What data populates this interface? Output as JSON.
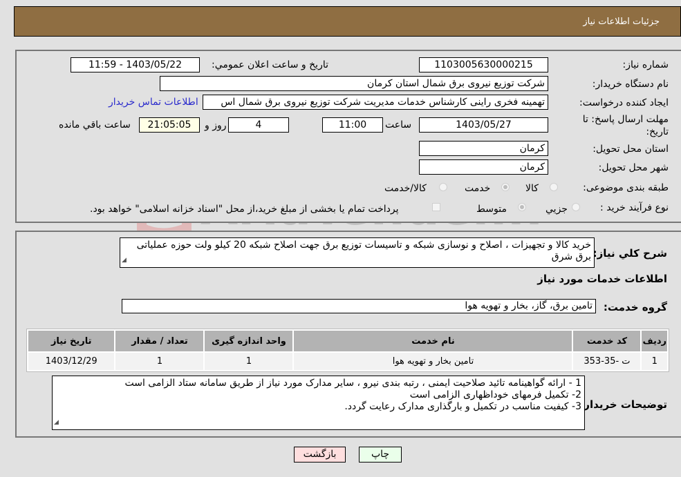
{
  "header": {
    "title": "جزئيات اطلاعات نیاز"
  },
  "form": {
    "need_number": {
      "label": "شماره نیاز:",
      "value": "1103005630000215"
    },
    "announce_datetime": {
      "label": "تاریخ و ساعت اعلان عمومي:",
      "value": "1403/05/22 - 11:59"
    },
    "buyer_org": {
      "label": "نام دستگاه خریدار:",
      "value": "شرکت توزیع نیروی برق شمال استان کرمان"
    },
    "requester": {
      "label": "ایجاد کننده درخواست:",
      "value": "تهمینه فخری راینی کارشناس خدمات مدیریت شرکت توزیع نیروی برق شمال اس",
      "contact_link": "اطلاعات تماس خریدار"
    },
    "deadline": {
      "label_line1": "مهلت ارسال پاسخ: تا",
      "label_line2": "تاریخ:",
      "date": "1403/05/27",
      "time_label": "ساعت",
      "time": "11:00",
      "days": "4",
      "days_label": "روز و",
      "remaining": "21:05:05",
      "remaining_label": "ساعت باقي مانده"
    },
    "province": {
      "label": "استان محل تحویل:",
      "value": "کرمان"
    },
    "city": {
      "label": "شهر محل تحویل:",
      "value": "کرمان"
    },
    "category": {
      "label": "طبقه بندی موضوعی:",
      "options": [
        "کالا",
        "خدمت",
        "کالا/خدمت"
      ],
      "selected": "خدمت"
    },
    "process": {
      "label": "نوع فرآیند خرید :",
      "options": [
        "جزیي",
        "متوسط"
      ],
      "selected": "متوسط",
      "payment_note": "پرداخت تمام یا بخشی از مبلغ خرید،از محل \"اسناد خزانه اسلامی\" خواهد بود."
    }
  },
  "description": {
    "label": "شرح کلي نیاز:",
    "value": "خرید کالا و تجهیزات ، اصلاح و نوسازی شبکه و تاسیسات توزیع برق جهت اصلاح شبکه 20 کیلو ولت حوزه عملیاتی برق شرق"
  },
  "services_section": {
    "title": "اطلاعات خدمات مورد نیاز",
    "group_label": "گروه خدمت:",
    "group_value": "تامین برق، گاز، بخار و تهویه هوا"
  },
  "table": {
    "headers": [
      "ردیف",
      "کد خدمت",
      "نام خدمت",
      "واحد اندازه گیری",
      "تعداد / مقدار",
      "تاریخ نیاز"
    ],
    "rows": [
      [
        "1",
        "ت -35-353",
        "تامین بخار و تهویه هوا",
        "1",
        "1",
        "1403/12/29"
      ]
    ]
  },
  "buyer_notes": {
    "label": "توضیحات خریدار:",
    "lines": [
      "1 - ارائه گواهینامه تائید صلاحیت ایمنی ، رتبه بندی نیرو  ، سایر مدارک مورد نیاز از طریق سامانه ستاد الزامی است",
      "2- تکمیل فرمهای خوداظهاری الزامی است",
      "3- کیفیت مناسب در تکمیل و بارگذاری مدارک رعایت گردد."
    ]
  },
  "buttons": {
    "print": "چاپ",
    "back": "بازگشت"
  },
  "colors": {
    "header_bg": "#8f6e42",
    "print_bg": "#eaffea",
    "back_bg": "#ffdede",
    "link": "#2a2acc"
  },
  "watermark": {
    "text": "AriaTender.neT"
  }
}
